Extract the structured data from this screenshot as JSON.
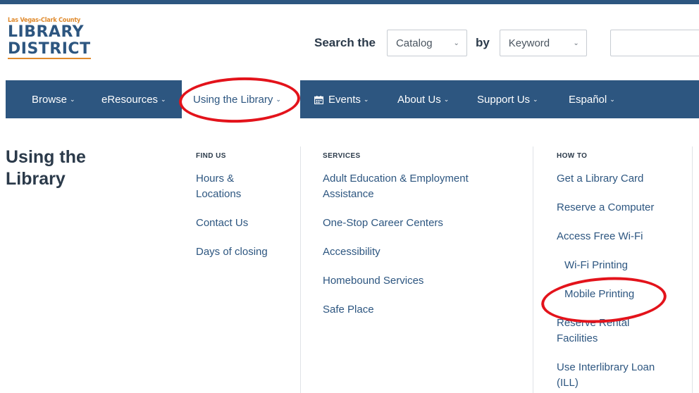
{
  "logo": {
    "subtitle": "Las Vegas-Clark County",
    "line1": "LIBRARY",
    "line2": "DISTRICT"
  },
  "search": {
    "label": "Search the",
    "scope_value": "Catalog",
    "by_label": "by",
    "type_value": "Keyword",
    "query_value": ""
  },
  "nav": {
    "items": [
      {
        "label": "Browse"
      },
      {
        "label": "eResources"
      },
      {
        "label": "Using the Library"
      },
      {
        "label": "Events"
      },
      {
        "label": "About Us"
      },
      {
        "label": "Support Us"
      },
      {
        "label": "Español"
      }
    ]
  },
  "menu": {
    "title": "Using the Library",
    "find_us": {
      "heading": "FIND US",
      "links": [
        "Hours & Locations",
        "Contact Us",
        "Days of closing"
      ]
    },
    "services": {
      "heading": "SERVICES",
      "links": [
        "Adult Education & Employment Assistance",
        "One-Stop Career Centers",
        "Accessibility",
        "Homebound Services",
        "Safe Place"
      ]
    },
    "how_to": {
      "heading": "HOW TO",
      "links": [
        "Get a Library Card",
        "Reserve a Computer",
        "Access Free Wi-Fi",
        "Wi-Fi Printing",
        "Mobile Printing",
        "Reserve Rental Facilities",
        "Use Interlibrary Loan (ILL)"
      ]
    }
  },
  "colors": {
    "brand_blue": "#2d5680",
    "brand_orange": "#e08a2c",
    "annotation_red": "#e3131b"
  },
  "icons": {
    "nav_caret": "chevron-down-icon",
    "events": "calendar-icon"
  }
}
